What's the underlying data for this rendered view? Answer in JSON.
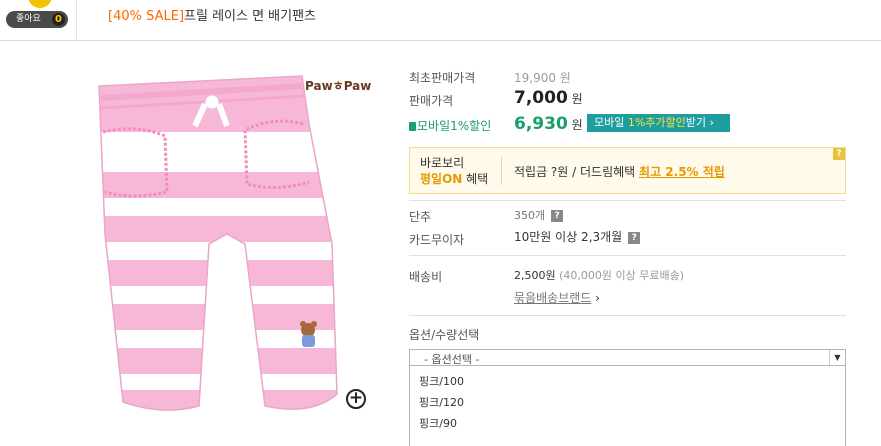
{
  "header": {
    "like_label": "좋아요",
    "like_count": "0",
    "sale_tag": "[40% SALE]",
    "product_name": "프릴 레이스 면 배기팬츠"
  },
  "product_image": {
    "brand_logo": "PawㅎPaw",
    "zoom_icon": "plus-circle-icon"
  },
  "price": {
    "original_label": "최초판매가격",
    "original_value": "19,900 원",
    "sale_label": "판매가격",
    "sale_value": "7,000",
    "won": "원",
    "mobile_label": "모바일1%할인",
    "mobile_value": "6,930",
    "mobile_button_prefix": "모바일 ",
    "mobile_button_highlight": "1%추가할인",
    "mobile_button_suffix": "받기 ›"
  },
  "promo": {
    "title_line1": "바로보리",
    "title_highlight": "평일ON",
    "title_suffix": " 혜택",
    "text": "적립금 ?원 / 더드림혜택 ",
    "link": "최고 2.5% 적립",
    "help_icon": "?"
  },
  "info": {
    "sold_label": "단추",
    "sold_value": "350개",
    "card_label": "카드무이자",
    "card_value": "10만원 이상 2,3개월",
    "shipping_label": "배송비",
    "shipping_fee": "2,500원",
    "shipping_note": "(40,000원 이상 무료배송)",
    "bundle_link": "묶음배송브랜드",
    "bundle_arrow": "›",
    "help_icon": "?"
  },
  "options": {
    "label": "옵션/수량선택",
    "placeholder": "- 옵션선택 -",
    "items": [
      "핑크/100",
      "핑크/120",
      "핑크/90"
    ]
  },
  "colors": {
    "sale_orange": "#ff6a00",
    "price_green": "#1a9e6a",
    "teal_button": "#1f9ea0",
    "pink_stripe": "#f7b8d8"
  }
}
